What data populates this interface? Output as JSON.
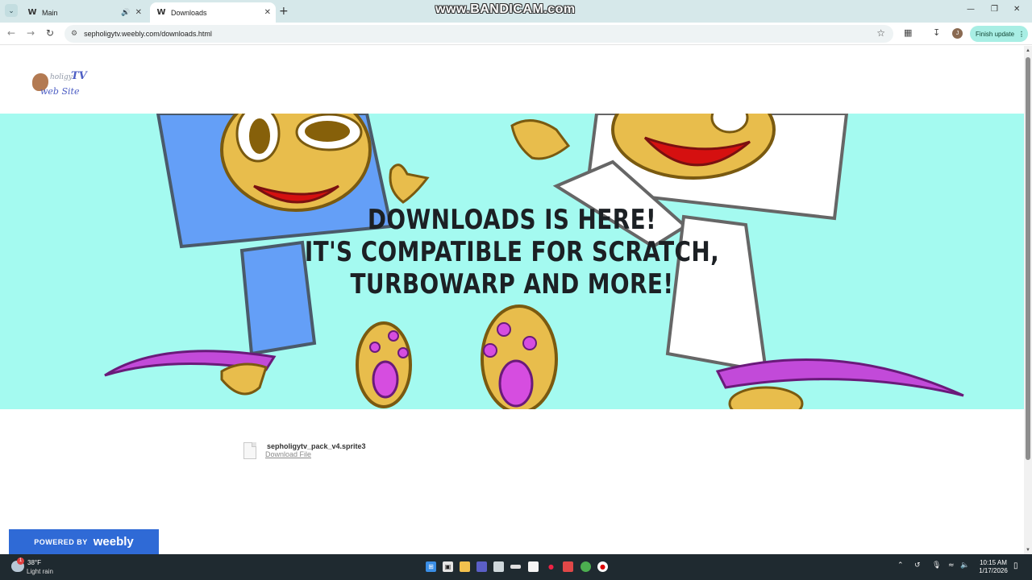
{
  "browser": {
    "tabs": [
      {
        "title": "Main",
        "favicon": "weebly-w",
        "audio": true
      },
      {
        "title": "Downloads",
        "favicon": "weebly-w",
        "active": true
      }
    ],
    "url": "sepholigytv.weebly.com/downloads.html",
    "finish_update_label": "Finish update",
    "profile_initial": "J",
    "watermark": "www.BANDICAM.com"
  },
  "site": {
    "logo": {
      "small": "holigy",
      "tv": "TV",
      "sub": "web Site"
    },
    "headline": [
      "DOWNLOADS IS HERE!",
      "IT'S COMPATIBLE FOR SCRATCH,",
      "TURBOWARP AND MORE!"
    ],
    "banner_color": "#a4faf0",
    "file": {
      "name": "sepholigytv_pack_v4.sprite3",
      "link_label": "Download File"
    },
    "footer": {
      "powered_by": "POWERED BY",
      "brand": "weebly",
      "color": "#2f6ad6"
    }
  },
  "taskbar": {
    "weather": {
      "temp": "38°F",
      "condition": "Light rain",
      "badge": "1"
    },
    "time": "10:15 AM",
    "date": "1/17/2026"
  }
}
